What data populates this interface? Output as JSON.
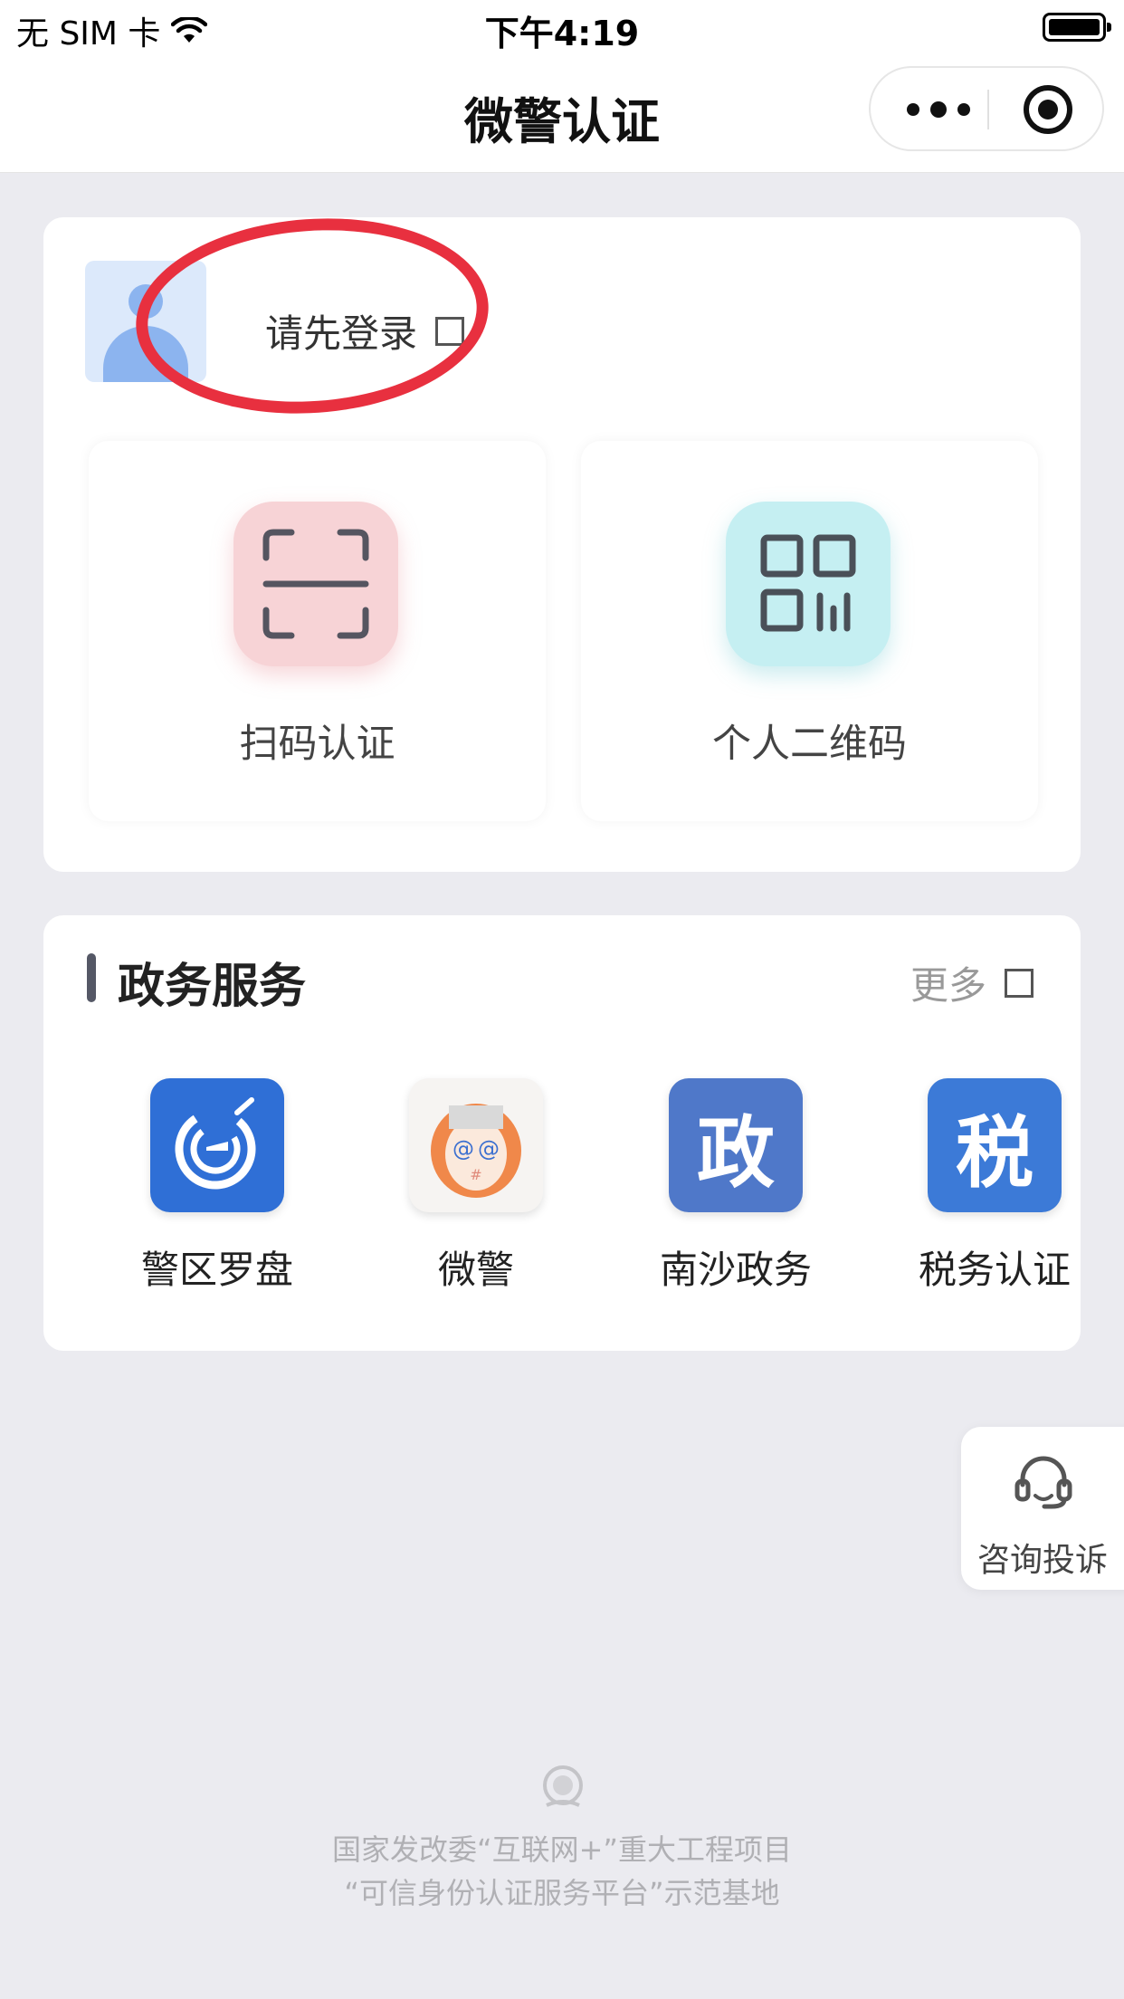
{
  "status_bar": {
    "carrier": "无 SIM 卡",
    "time": "下午4:19",
    "battery_level": 1.0
  },
  "nav": {
    "title": "微警认证",
    "more_icon": "more-dots-icon",
    "close_icon": "target-close-icon"
  },
  "user": {
    "login_prompt": "请先登录",
    "avatar_icon": "user-avatar-icon",
    "annotation_color": "#e8303f"
  },
  "quick_actions": [
    {
      "label": "扫码认证",
      "icon": "scan-frame-icon"
    },
    {
      "label": "个人二维码",
      "icon": "qr-code-icon"
    }
  ],
  "services": {
    "title": "政务服务",
    "more_label": "更多",
    "items": [
      {
        "label": "警区罗盘",
        "icon": "police-compass-icon",
        "color": "#2f6fd6"
      },
      {
        "label": "微警",
        "icon": "weijing-cartoon-icon",
        "color": "#f0884a"
      },
      {
        "label": "南沙政务",
        "icon": "zheng-character-icon",
        "color": "#4f78c9",
        "glyph": "政"
      },
      {
        "label": "税务认证",
        "icon": "shui-character-icon",
        "color": "#3c7ad7",
        "glyph": "税"
      }
    ]
  },
  "float_button": {
    "label": "咨询投诉",
    "icon": "headset-icon"
  },
  "footer": {
    "emblem_icon": "national-emblem-icon",
    "line1": "国家发改委“互联网+”重大工程项目",
    "line2": "“可信身份认证服务平台”示范基地"
  }
}
